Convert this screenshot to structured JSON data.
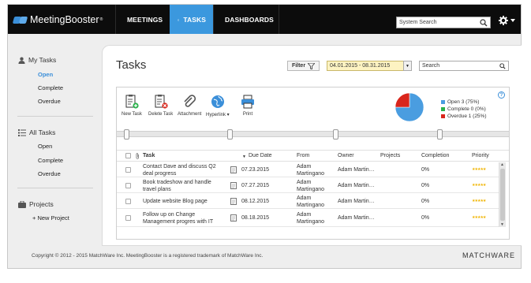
{
  "app": {
    "logo_text": "MeetingBooster",
    "logo_mark": "®"
  },
  "nav": {
    "tabs": [
      {
        "label": "MEETINGS",
        "icon": "people-icon"
      },
      {
        "label": "TASKS",
        "icon": "check-circle-icon",
        "active": true
      },
      {
        "label": "DASHBOARDS",
        "icon": "chart-icon"
      }
    ],
    "search_placeholder": "System Search"
  },
  "sidebar": {
    "my_tasks": {
      "title": "My Tasks",
      "items": [
        "Open",
        "Complete",
        "Overdue"
      ]
    },
    "all_tasks": {
      "title": "All Tasks",
      "items": [
        "Open",
        "Complete",
        "Overdue"
      ]
    },
    "projects": {
      "title": "Projects",
      "new_project": "+ New Project"
    }
  },
  "main": {
    "title": "Tasks",
    "filter_label": "Filter",
    "date_range": "04.01.2015 - 08.31.2015",
    "search_placeholder": "Search"
  },
  "toolbar": {
    "new_task": "New Task",
    "delete_task": "Delete Task",
    "attachment": "Attachment",
    "hyperlink": "Hyperlink",
    "print": "Print"
  },
  "summary": {
    "legend": [
      {
        "label": "Open 3 (75%)",
        "color": "#4a9de0"
      },
      {
        "label": "Complete 0 (0%)",
        "color": "#2bb24c"
      },
      {
        "label": "Overdue 1 (25%)",
        "color": "#d9261c"
      }
    ],
    "pie_values": [
      75,
      0,
      25
    ]
  },
  "table": {
    "headers": {
      "task": "Task",
      "due": "Due Date",
      "from": "From",
      "owner": "Owner",
      "projects": "Projects",
      "completion": "Completion",
      "priority": "Priority"
    },
    "rows": [
      {
        "task1": "Contact Dave and discuss Q2",
        "task2": "deal progress",
        "due": "07.23.2015",
        "from1": "Adam",
        "from2": "Martingano",
        "owner": "Adam Martin…",
        "completion": "0%"
      },
      {
        "task1": "Book tradeshow and handle",
        "task2": "travel plans",
        "due": "07.27.2015",
        "from1": "Adam",
        "from2": "Martingano",
        "owner": "Adam Martin…",
        "completion": "0%"
      },
      {
        "task1": "Update website Blog page",
        "task2": "",
        "due": "08.12.2015",
        "from1": "Adam",
        "from2": "Martingano",
        "owner": "Adam Martin…",
        "completion": "0%"
      },
      {
        "task1": "Follow up on Change",
        "task2": "Management progres with IT",
        "due": "08.18.2015",
        "from1": "Adam",
        "from2": "Martingano",
        "owner": "Adam Martin…",
        "completion": "0%"
      }
    ],
    "priority_stars": "★★★★★"
  },
  "footer": {
    "copyright": "Copyright © 2012 - 2015 MatchWare Inc. MeetingBooster is a registered trademark of MatchWare Inc.",
    "brand": "MATCHWARE"
  }
}
